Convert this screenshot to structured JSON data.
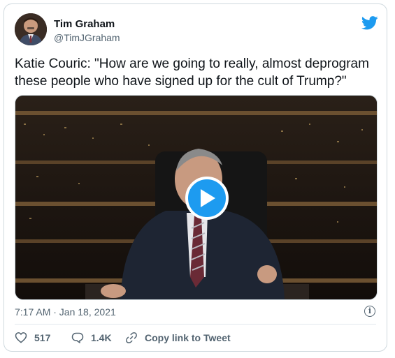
{
  "author": {
    "name": "Tim Graham",
    "handle": "@TimJGraham"
  },
  "tweet": {
    "text": "Katie Couric: \"How are we going to really, almost deprogram these people who have signed up for the cult of Trump?\"",
    "timestamp": "7:17 AM · Jan 18, 2021"
  },
  "actions": {
    "likes": "517",
    "replies": "1.4K",
    "copy_link": "Copy link to Tweet"
  },
  "icons": {
    "logo": "twitter-bird-icon",
    "play": "play-icon",
    "info": "info-icon",
    "like": "heart-icon",
    "reply": "reply-icon",
    "link": "link-icon"
  },
  "colors": {
    "brand": "#1d9bf0",
    "text": "#0f1419",
    "muted": "#536471"
  }
}
